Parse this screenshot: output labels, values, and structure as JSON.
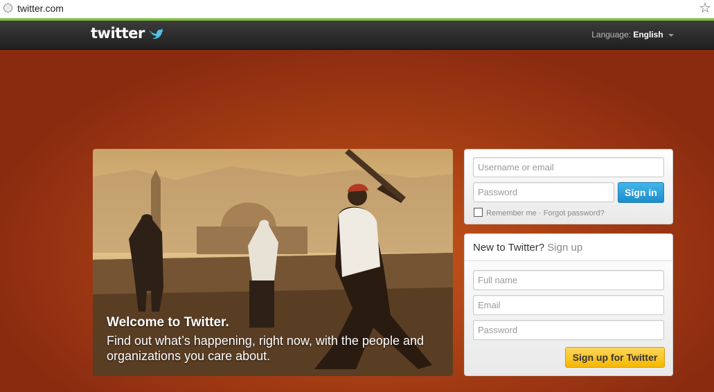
{
  "browser": {
    "url": "twitter.com"
  },
  "header": {
    "logo_text": "twitter",
    "language_label": "Language:",
    "language_value": "English"
  },
  "hero": {
    "title": "Welcome to Twitter.",
    "text": "Find out what’s happening, right now, with the people and organizations you care about."
  },
  "signin": {
    "username_placeholder": "Username or email",
    "password_placeholder": "Password",
    "button_label": "Sign in",
    "remember_label": "Remember me",
    "separator": "·",
    "forgot_label": "Forgot password?"
  },
  "signup": {
    "heading": "New to Twitter?",
    "heading_link": "Sign up",
    "fullname_placeholder": "Full name",
    "email_placeholder": "Email",
    "password_placeholder": "Password",
    "button_label": "Sign up for Twitter"
  },
  "icons": {
    "address": "globe-icon",
    "bookmark": "star-icon",
    "logo": "bird-icon",
    "language": "caret-down-icon"
  },
  "colors": {
    "background": "#8a2b10",
    "signin_button": "#1f8cc9",
    "signup_button": "#f5b700"
  }
}
